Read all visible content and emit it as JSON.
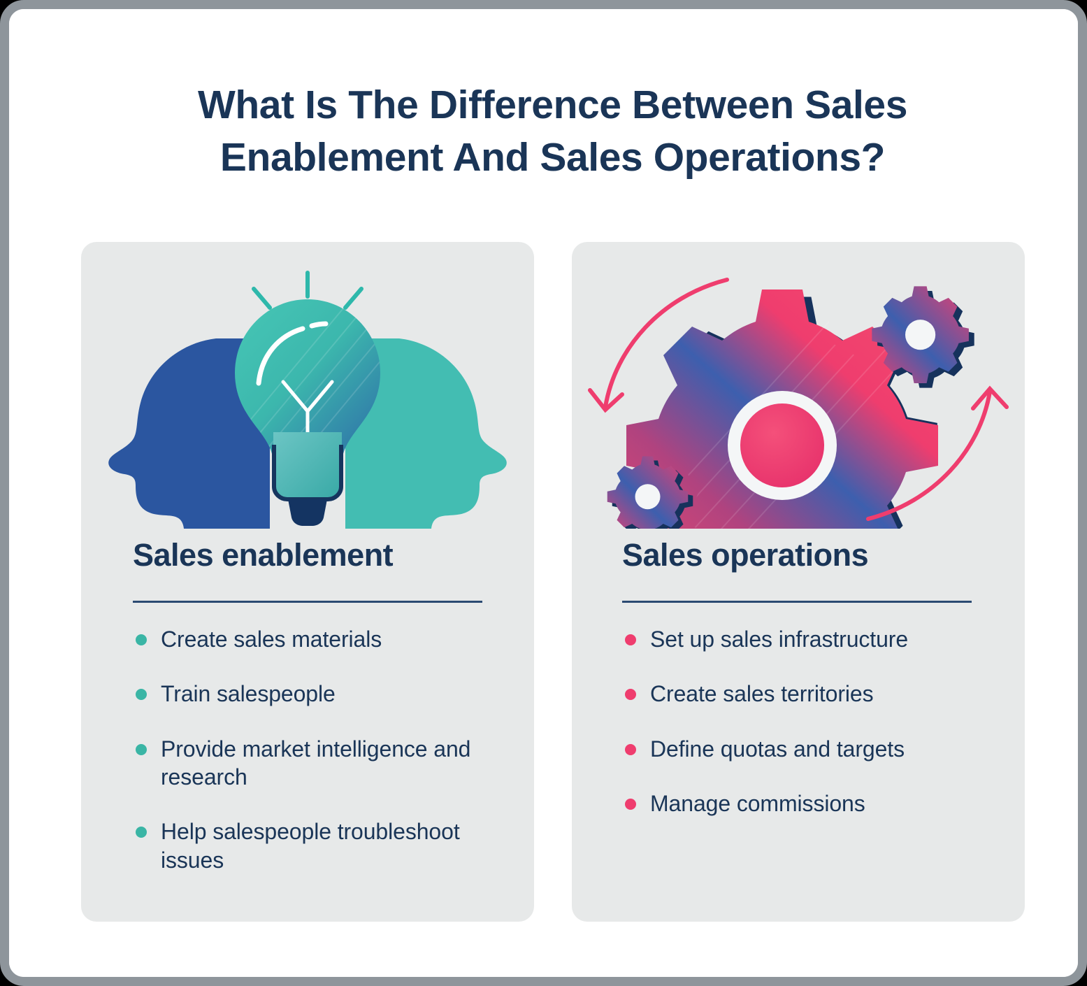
{
  "title": "What Is The Difference Between Sales Enablement And Sales Operations?",
  "colors": {
    "navy": "#1a3557",
    "teal": "#3ab5a5",
    "pink": "#ef3d6e",
    "blue": "#2b56a0",
    "card_bg": "#e7e9e9",
    "page_bg": "#ffffff",
    "frame_border": "#8e959b"
  },
  "columns": [
    {
      "heading": "Sales enablement",
      "illustration": "lightbulb-heads-icon",
      "accent": "#3ab5a5",
      "items": [
        "Create sales materials",
        "Train salespeople",
        "Provide market intelligence and research",
        "Help salespeople troubleshoot issues"
      ]
    },
    {
      "heading": "Sales operations",
      "illustration": "gears-arrows-icon",
      "accent": "#ef3d6e",
      "items": [
        "Set up sales infrastructure",
        "Create sales territories",
        "Define quotas and targets",
        "Manage commissions"
      ]
    }
  ]
}
